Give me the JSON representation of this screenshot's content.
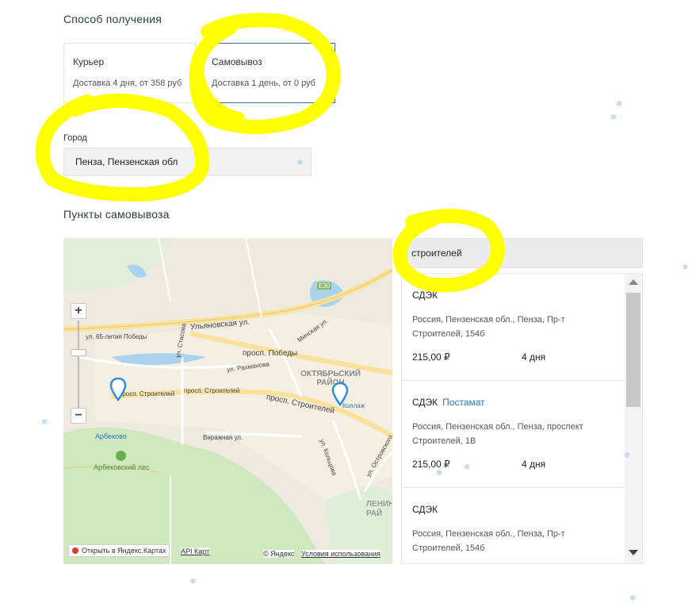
{
  "delivery": {
    "title": "Способ получения",
    "options": [
      {
        "label": "Курьер",
        "detail": "Доставка 4 дня, от 358 руб",
        "selected": false
      },
      {
        "label": "Самовывоз",
        "detail": "Доставка 1 день, от 0 руб",
        "selected": true
      }
    ]
  },
  "city": {
    "label": "Город",
    "value": "Пенза, Пензенская обл"
  },
  "pickup": {
    "title": "Пункты самовывоза"
  },
  "map": {
    "zoom_in": "+",
    "zoom_out": "−",
    "labels": {
      "e30": "E30",
      "ulyanovskaya": "Ульяновская ул.",
      "u65": "ул. 65-летия Победы",
      "minskaya": "Минская ул.",
      "prospekt_pobedy": "просп. Победы",
      "rakhmanova": "ул. Рахманова",
      "stasova": "ул. Стасова",
      "oktyabrsky": "ОКТЯБРЬСКИЙ РАЙОН",
      "stroiteley1": "просп. Строителей",
      "stroiteley2": "просп. Строителей",
      "stroiteley3": "просп. Строителей",
      "kollazh": "Коллаж",
      "arbekovo": "Арбеково",
      "virazhnaya": "Виражная ул.",
      "koltsova": "ул. Кольцова",
      "ostrovskogo": "ул. Островского",
      "arbekovsky_les": "Арбековский лес",
      "leninsky": "ЛЕНИН РАЙ"
    },
    "open_yandex": "Открыть в Яндекс.Картах",
    "api": "API Карт",
    "copyright": "© Яндекс",
    "terms": "Условия использования"
  },
  "search": {
    "value": "строителей"
  },
  "results": [
    {
      "provider": "СДЭК",
      "tag": "",
      "address": "Россия, Пензенская обл., Пенза, Пр-т Строителей, 154б",
      "price": "215,00 ₽",
      "days": "4 дня"
    },
    {
      "provider": "СДЭК",
      "tag": "Постамат",
      "address": "Россия, Пензенская обл., Пенза, проспект Строителей, 1В",
      "price": "215,00 ₽",
      "days": "4 дня"
    },
    {
      "provider": "СДЭК",
      "tag": "",
      "address": "Россия, Пензенская обл., Пенза, Пр-т Строителей, 154б",
      "price": "",
      "days": ""
    }
  ],
  "colors": {
    "highlight": "#ffff00",
    "selected_border": "#3b6f9e",
    "link": "#2b78c2",
    "map_road": "#fbe29a",
    "map_water": "#a9d3ee",
    "map_green": "#cfe8c0"
  },
  "icons": {
    "marker": "map-pin-icon",
    "snowflake": "snowflake-icon",
    "scroll_up": "triangle-up-icon",
    "scroll_down": "triangle-down-icon"
  }
}
